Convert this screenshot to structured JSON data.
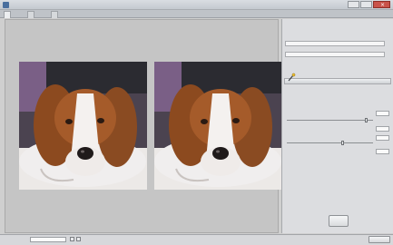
{
  "window": {
    "title": ""
  },
  "tabs": [
    {
      "label": ""
    },
    {
      "label": ""
    },
    {
      "label": ""
    }
  ],
  "images": {
    "left_caption": "",
    "right_caption": ""
  },
  "panel": {
    "lines": [
      "",
      "",
      "",
      "",
      "",
      "",
      ""
    ],
    "section_title": "",
    "section_lines": [
      "",
      ""
    ],
    "slider_labels": [
      "",
      "",
      "",
      ""
    ],
    "slider_values": [
      "",
      "",
      "",
      ""
    ],
    "save_label": ""
  },
  "status": {
    "zoom": "",
    "text": "",
    "nav": "",
    "done_label": ""
  },
  "colors": {
    "accent": "#4a6f9e",
    "close": "#c9534a",
    "background": "#cfcfcf"
  }
}
